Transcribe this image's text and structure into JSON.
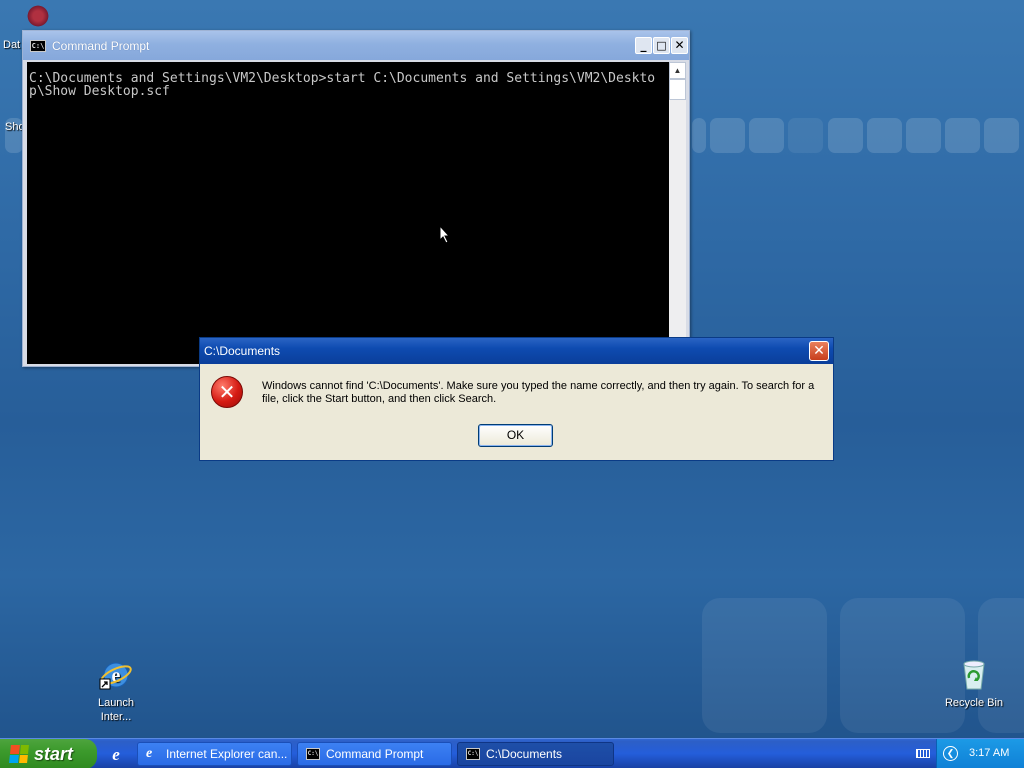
{
  "desktop": {
    "icons": [
      {
        "label_line1": "Launch",
        "label_line2": "Inter...",
        "icon": "internet-explorer-icon"
      },
      {
        "label_line1": "Recycle Bin",
        "label_line2": "",
        "icon": "recycle-bin-icon"
      }
    ],
    "partial_labels": [
      "Dat",
      "Sho"
    ]
  },
  "cmd_window": {
    "title": "Command Prompt",
    "icon": "console-icon",
    "lines": [
      "C:\\Documents and Settings\\VM2\\Desktop>start C:\\Documents and Settings\\VM2\\Deskto",
      "p\\Show Desktop.scf"
    ]
  },
  "dialog": {
    "title": "C:\\Documents",
    "message": "Windows cannot find 'C:\\Documents'. Make sure you typed the name correctly, and then try again. To search for a file, click the Start button, and then click Search.",
    "ok_label": "OK",
    "icon": "error-icon"
  },
  "taskbar": {
    "start_label": "start",
    "buttons": [
      {
        "label": "Internet Explorer can...",
        "active": false
      },
      {
        "label": "Command Prompt",
        "active": false
      },
      {
        "label": "C:\\Documents",
        "active": true
      }
    ],
    "clock": "3:17 AM"
  },
  "colors": {
    "desktop": "#2f6aa6",
    "taskbar": "#245edb",
    "start_button": "#3c9a2c",
    "dialog_titlebar": "#0e4bb0",
    "console_bg": "#000000"
  }
}
